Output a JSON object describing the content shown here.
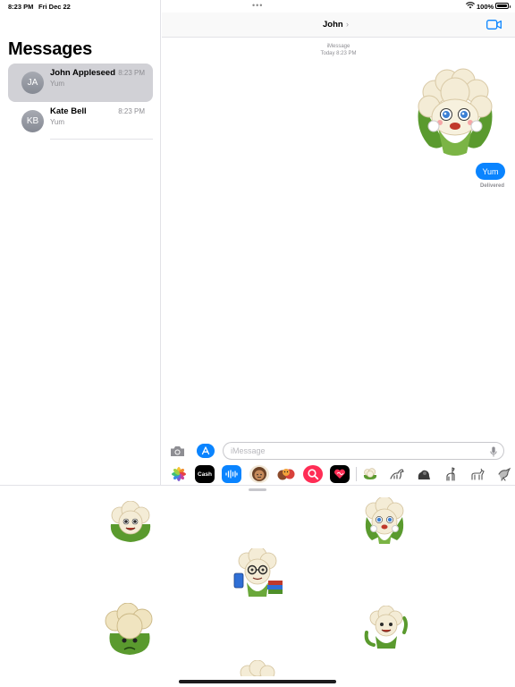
{
  "status_bar": {
    "time": "8:23 PM",
    "date": "Fri Dec 22",
    "battery": "100%",
    "battery_level": 1.0,
    "wifi_icon": "wifi-icon",
    "multitask_icon": "more-dots-icon"
  },
  "sidebar": {
    "title": "Messages",
    "conversations": [
      {
        "initials": "JA",
        "name": "John Appleseed",
        "time": "8:23 PM",
        "preview": "Yum",
        "selected": true
      },
      {
        "initials": "KB",
        "name": "Kate Bell",
        "time": "8:23 PM",
        "preview": "Yum",
        "selected": false
      }
    ]
  },
  "chat": {
    "contact_name": "John",
    "chevron": "›",
    "video_icon": "video-camera-icon",
    "service_label": "iMessage",
    "timestamp": "Today 8:23 PM",
    "messages": [
      {
        "type": "sticker",
        "sticker": "cauliflower-cheering-icon",
        "outgoing": true
      },
      {
        "type": "text",
        "text": "Yum",
        "outgoing": true
      }
    ],
    "delivery_status": "Delivered"
  },
  "composer": {
    "placeholder": "iMessage",
    "camera_icon": "camera-icon",
    "app_store_icon": "app-store-icon",
    "mic_icon": "microphone-icon"
  },
  "app_strip": {
    "apps": [
      {
        "name": "photos-app-icon",
        "label": ""
      },
      {
        "name": "apple-cash-app-icon",
        "label": "Cash"
      },
      {
        "name": "audio-message-app-icon",
        "label": ""
      },
      {
        "name": "memoji-app-icon",
        "label": ""
      },
      {
        "name": "animoji-app-icon",
        "label": ""
      },
      {
        "name": "search-images-app-icon",
        "label": ""
      },
      {
        "name": "digital-touch-app-icon",
        "label": ""
      },
      {
        "name": "cauliflower-stickers-app-icon",
        "label": ""
      },
      {
        "name": "dinosaur-stickers-app-icon",
        "label": ""
      },
      {
        "name": "gorilla-stickers-app-icon",
        "label": ""
      },
      {
        "name": "llama-stickers-app-icon",
        "label": ""
      },
      {
        "name": "goat-stickers-app-icon",
        "label": ""
      },
      {
        "name": "bird-stickers-app-icon",
        "label": ""
      }
    ]
  },
  "sticker_drawer": {
    "stickers": [
      "cauliflower-smiling-sticker",
      "cauliflower-cheering-sticker",
      "cauliflower-reading-sticker",
      "cauliflower-sad-sticker",
      "cauliflower-waving-sticker",
      "cauliflower-partial-sticker"
    ]
  },
  "colors": {
    "accent": "#0a84ff",
    "selected_row": "#d1d1d6",
    "secondary_text": "#8e8e93"
  }
}
